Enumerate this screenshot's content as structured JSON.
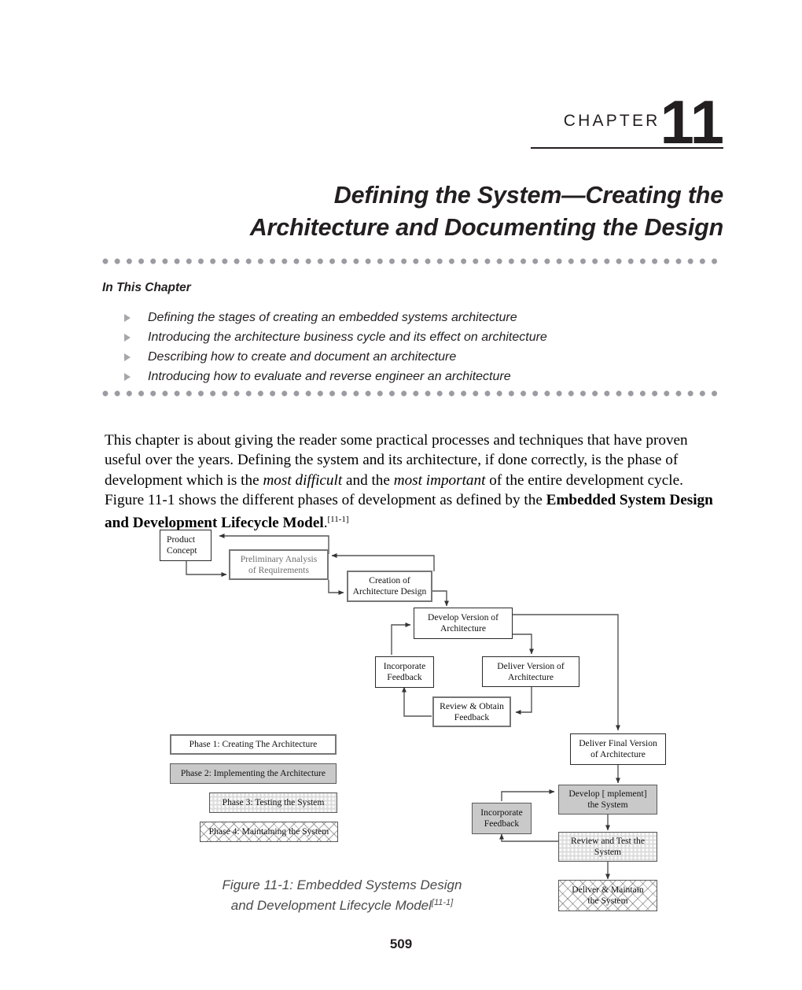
{
  "header": {
    "chapter_word": "CHAPTER",
    "chapter_number": "11"
  },
  "title": {
    "line1": "Defining the System—Creating the",
    "line2": "Architecture and Documenting the Design"
  },
  "in_this_chapter": {
    "heading": "In This Chapter",
    "items": [
      "Defining the stages of creating an embedded systems architecture",
      "Introducing the architecture business cycle and its effect on architecture",
      "Describing how to create and document an architecture",
      "Introducing how to evaluate and reverse engineer an architecture"
    ]
  },
  "body": {
    "p1_a": "This chapter is about giving the reader some practical processes and techniques that have proven useful over the years. Defining the system and its architecture, if done correctly, is the phase of development which is the ",
    "p1_em1": "most difficult",
    "p1_b": " and the ",
    "p1_em2": "most important",
    "p1_c": " of the entire development cycle. Figure 11-1 shows the different phases of development as defined by the ",
    "p1_bold": "Embedded System Design and Development Lifecycle Model",
    "p1_d": ".",
    "p1_ref": "[11-1]"
  },
  "figure": {
    "caption_line1": "Figure 11-1: Embedded Systems Design",
    "caption_line2": "and Development Lifecycle Model",
    "caption_ref": "[11-1]",
    "boxes": {
      "product_concept": {
        "line1": "Product",
        "line2": "Concept"
      },
      "preliminary_analysis": {
        "line1": "Preliminary Analysis",
        "line2": "of  Requirements"
      },
      "creation_architecture": {
        "line1": "Creation of",
        "line2": "Architecture Design"
      },
      "develop_version": {
        "line1": "Develop Version of",
        "line2": "Architecture"
      },
      "incorporate_feedback_1": {
        "line1": "Incorporate",
        "line2": "Feedback"
      },
      "deliver_version": {
        "line1": "Deliver Version of",
        "line2": "Architecture"
      },
      "review_obtain": {
        "line1": "Review & Obtain",
        "line2": "Feedback"
      },
      "deliver_final": {
        "line1": "Deliver Final Version",
        "line2": "of Architecture"
      },
      "develop_implement": {
        "line1": "Develop [ mplement]",
        "line2": "the System"
      },
      "incorporate_feedback_2": {
        "line1": "Incorporate",
        "line2": "Feedback"
      },
      "review_test": {
        "line1": "Review and Test the",
        "line2": "System"
      },
      "deliver_maintain": {
        "line1": "Deliver & Maintain",
        "line2": "the System"
      }
    },
    "legend": {
      "phase1": "Phase 1: Creating The Architecture",
      "phase2": "Phase 2: Implementing the Architecture",
      "phase3": "Phase 3: Testing the System",
      "phase4": "Phase 4: Maintaining the System"
    }
  },
  "page_number": "509",
  "colors": {
    "ink": "#231f20",
    "rule_dot": "#9b9ba2",
    "bullet": "#a6a6ac",
    "box_gray_fill": "#c9c9c9",
    "box_dot_fill": "#dedede",
    "caption": "#4a4a4a"
  }
}
